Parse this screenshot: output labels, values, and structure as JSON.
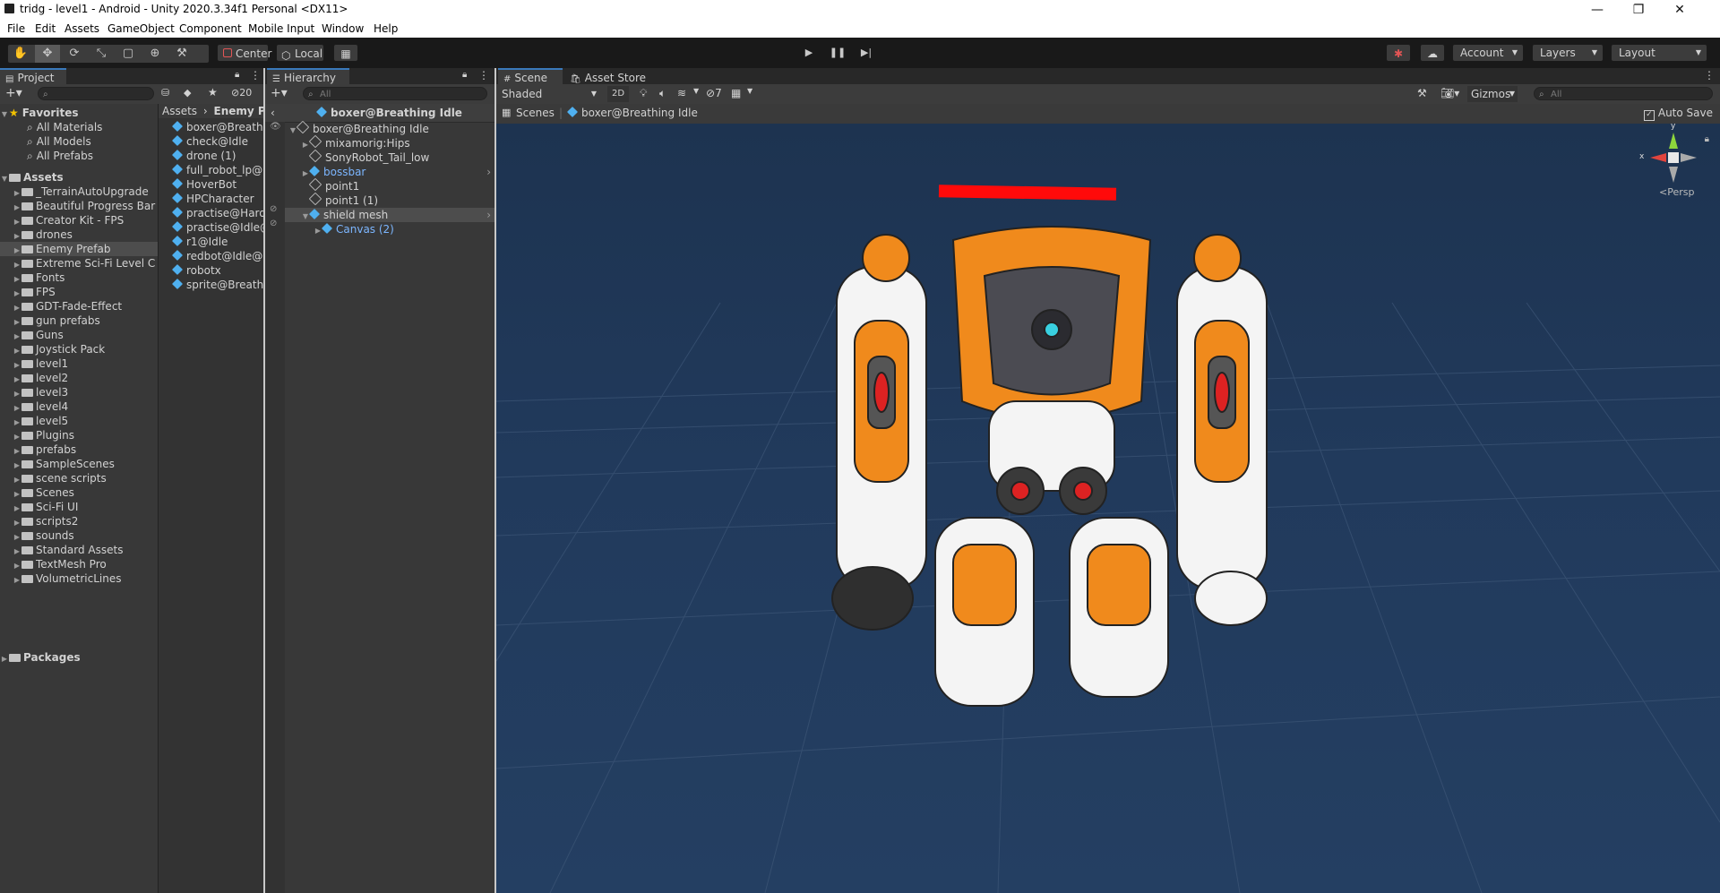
{
  "window": {
    "title": "tridg - level1 - Android - Unity 2020.3.34f1 Personal <DX11>",
    "minimize": "—",
    "restore": "❐",
    "close": "✕"
  },
  "menu": [
    "File",
    "Edit",
    "Assets",
    "GameObject",
    "Component",
    "Mobile Input",
    "Window",
    "Help"
  ],
  "toolbar": {
    "pivot": "Center",
    "space": "Local",
    "account": "Account",
    "layers": "Layers",
    "layout": "Layout"
  },
  "project": {
    "tab": "Project",
    "hidden_count": "20",
    "favorites_label": "Favorites",
    "favorites": [
      "All Materials",
      "All Models",
      "All Prefabs"
    ],
    "assets_label": "Assets",
    "folders": [
      "_TerrainAutoUpgrade",
      "Beautiful Progress Bar",
      "Creator Kit - FPS",
      "drones",
      "Enemy Prefab",
      "Extreme Sci-Fi Level C",
      "Fonts",
      "FPS",
      "GDT-Fade-Effect",
      "gun prefabs",
      "Guns",
      "Joystick Pack",
      "level1",
      "level2",
      "level3",
      "level4",
      "level5",
      "Plugins",
      "prefabs",
      "SampleScenes",
      "scene scripts",
      "Scenes",
      "Sci-Fi UI",
      "scripts2",
      "sounds",
      "Standard Assets",
      "TextMesh Pro",
      "VolumetricLines"
    ],
    "selected_folder": "Enemy Prefab",
    "packages_label": "Packages",
    "breadcrumb_root": "Assets",
    "breadcrumb_current": "Enemy Pre",
    "files": [
      "boxer@Breathir",
      "check@Idle",
      "drone (1)",
      "full_robot_lp@Ic",
      "HoverBot",
      "HPCharacter",
      "practise@Hard",
      "practise@Idle@",
      "r1@Idle",
      "redbot@Idle@Ic",
      "robotx",
      "sprite@Breathir"
    ]
  },
  "hierarchy": {
    "tab": "Hierarchy",
    "search_placeholder": "All",
    "prefab_header": "boxer@Breathing Idle",
    "items": [
      {
        "label": "boxer@Breathing Idle",
        "depth": 0,
        "expanded": true,
        "blue": false
      },
      {
        "label": "mixamorig:Hips",
        "depth": 1,
        "expanded": false,
        "blue": false
      },
      {
        "label": "SonyRobot_Tail_low",
        "depth": 1,
        "expanded": null,
        "blue": false
      },
      {
        "label": "bossbar",
        "depth": 1,
        "expanded": false,
        "blue": true
      },
      {
        "label": "point1",
        "depth": 1,
        "expanded": null,
        "blue": false
      },
      {
        "label": "point1 (1)",
        "depth": 1,
        "expanded": null,
        "blue": false
      },
      {
        "label": "shield mesh",
        "depth": 1,
        "expanded": true,
        "blue": false
      },
      {
        "label": "Canvas (2)",
        "depth": 2,
        "expanded": false,
        "blue": true
      }
    ]
  },
  "scene": {
    "tab": "Scene",
    "asset_store_tab": "Asset Store",
    "shading": "Shaded",
    "mode_2d": "2D",
    "hidden_count": "7",
    "gizmos": "Gizmos",
    "search_placeholder": "All",
    "breadcrumb_scenes": "Scenes",
    "breadcrumb_prefab": "boxer@Breathing Idle",
    "auto_save": "Auto Save",
    "persp": "Persp",
    "axis_x": "x",
    "axis_y": "y"
  }
}
